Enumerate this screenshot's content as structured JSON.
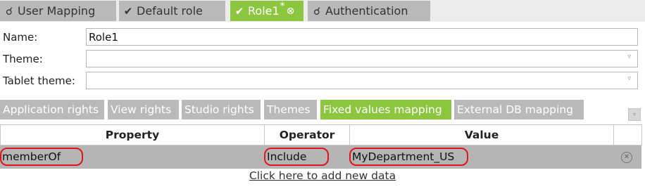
{
  "top_tabs": [
    {
      "label": "User Mapping",
      "icon": "user-mapping-icon",
      "active": false
    },
    {
      "label": "Default role",
      "icon": "check-icon",
      "active": false
    },
    {
      "label": "Role1",
      "icon": "check-icon",
      "active": true,
      "modified_marker": "*",
      "close_glyph": "⊗"
    },
    {
      "label": "Authentication",
      "icon": "authentication-icon",
      "active": false
    }
  ],
  "form": {
    "name_label": "Name:",
    "name_value": "Role1",
    "theme_label": "Theme:",
    "theme_value": "",
    "tablet_theme_label": "Tablet theme:",
    "tablet_theme_value": ""
  },
  "section_tabs": [
    {
      "label": "Application rights",
      "active": false
    },
    {
      "label": "View rights",
      "active": false
    },
    {
      "label": "Studio rights",
      "active": false
    },
    {
      "label": "Themes",
      "active": false
    },
    {
      "label": "Fixed values mapping",
      "active": true
    },
    {
      "label": "External DB mapping",
      "active": false
    }
  ],
  "table": {
    "columns": [
      "Property",
      "Operator",
      "Value"
    ],
    "rows": [
      {
        "property": "memberOf",
        "operator": "Include",
        "value": "MyDepartment_US"
      }
    ],
    "add_link": "Click here to add new data"
  },
  "colors": {
    "accent_green": "#8cc63f",
    "inactive_tab": "#b9b9b9",
    "row_bg": "#b5b5b5",
    "highlight_ring": "#e0141b"
  }
}
